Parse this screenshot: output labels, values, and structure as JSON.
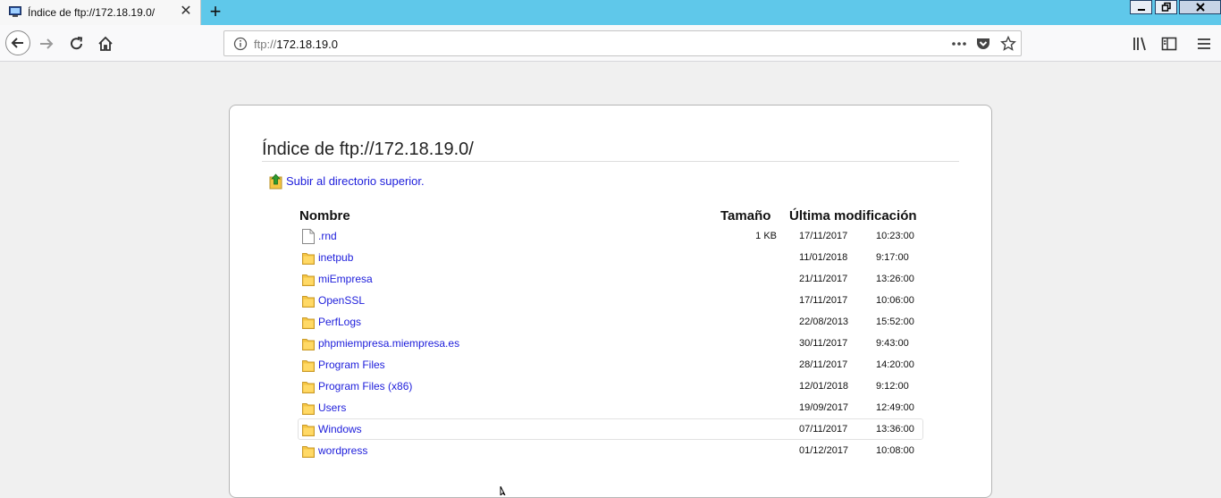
{
  "tab": {
    "title": "Índice de ftp://172.18.19.0/",
    "favicon": "computer-icon"
  },
  "window_controls": {
    "minimize_icon": "minimize-icon",
    "maximize_icon": "restore-icon",
    "close_icon": "close-icon"
  },
  "navbar": {
    "url_scheme": "ftp://",
    "url_host": "172.18.19.0"
  },
  "page": {
    "heading": "Índice de ftp://172.18.19.0/",
    "up_link": "Subir al directorio superior.",
    "columns": {
      "name": "Nombre",
      "size": "Tamaño",
      "modified": "Última modificación"
    },
    "entries": [
      {
        "name": ".rnd",
        "type": "file",
        "size": "1 KB",
        "date": "17/11/2017",
        "time": "10:23:00"
      },
      {
        "name": "inetpub",
        "type": "folder",
        "size": "",
        "date": "11/01/2018",
        "time": "9:17:00"
      },
      {
        "name": "miEmpresa",
        "type": "folder",
        "size": "",
        "date": "21/11/2017",
        "time": "13:26:00"
      },
      {
        "name": "OpenSSL",
        "type": "folder",
        "size": "",
        "date": "17/11/2017",
        "time": "10:06:00"
      },
      {
        "name": "PerfLogs",
        "type": "folder",
        "size": "",
        "date": "22/08/2013",
        "time": "15:52:00"
      },
      {
        "name": "phpmiempresa.miempresa.es",
        "type": "folder",
        "size": "",
        "date": "30/11/2017",
        "time": "9:43:00"
      },
      {
        "name": "Program Files",
        "type": "folder",
        "size": "",
        "date": "28/11/2017",
        "time": "14:20:00"
      },
      {
        "name": "Program Files (x86)",
        "type": "folder",
        "size": "",
        "date": "12/01/2018",
        "time": "9:12:00"
      },
      {
        "name": "Users",
        "type": "folder",
        "size": "",
        "date": "19/09/2017",
        "time": "12:49:00"
      },
      {
        "name": "Windows",
        "type": "folder",
        "size": "",
        "date": "07/11/2017",
        "time": "13:36:00",
        "hover": true
      },
      {
        "name": "wordpress",
        "type": "folder",
        "size": "",
        "date": "01/12/2017",
        "time": "10:08:00"
      }
    ]
  },
  "colors": {
    "tabbar": "#5fc8ea",
    "link": "#1d1ddb",
    "folder": "#f5c542"
  }
}
